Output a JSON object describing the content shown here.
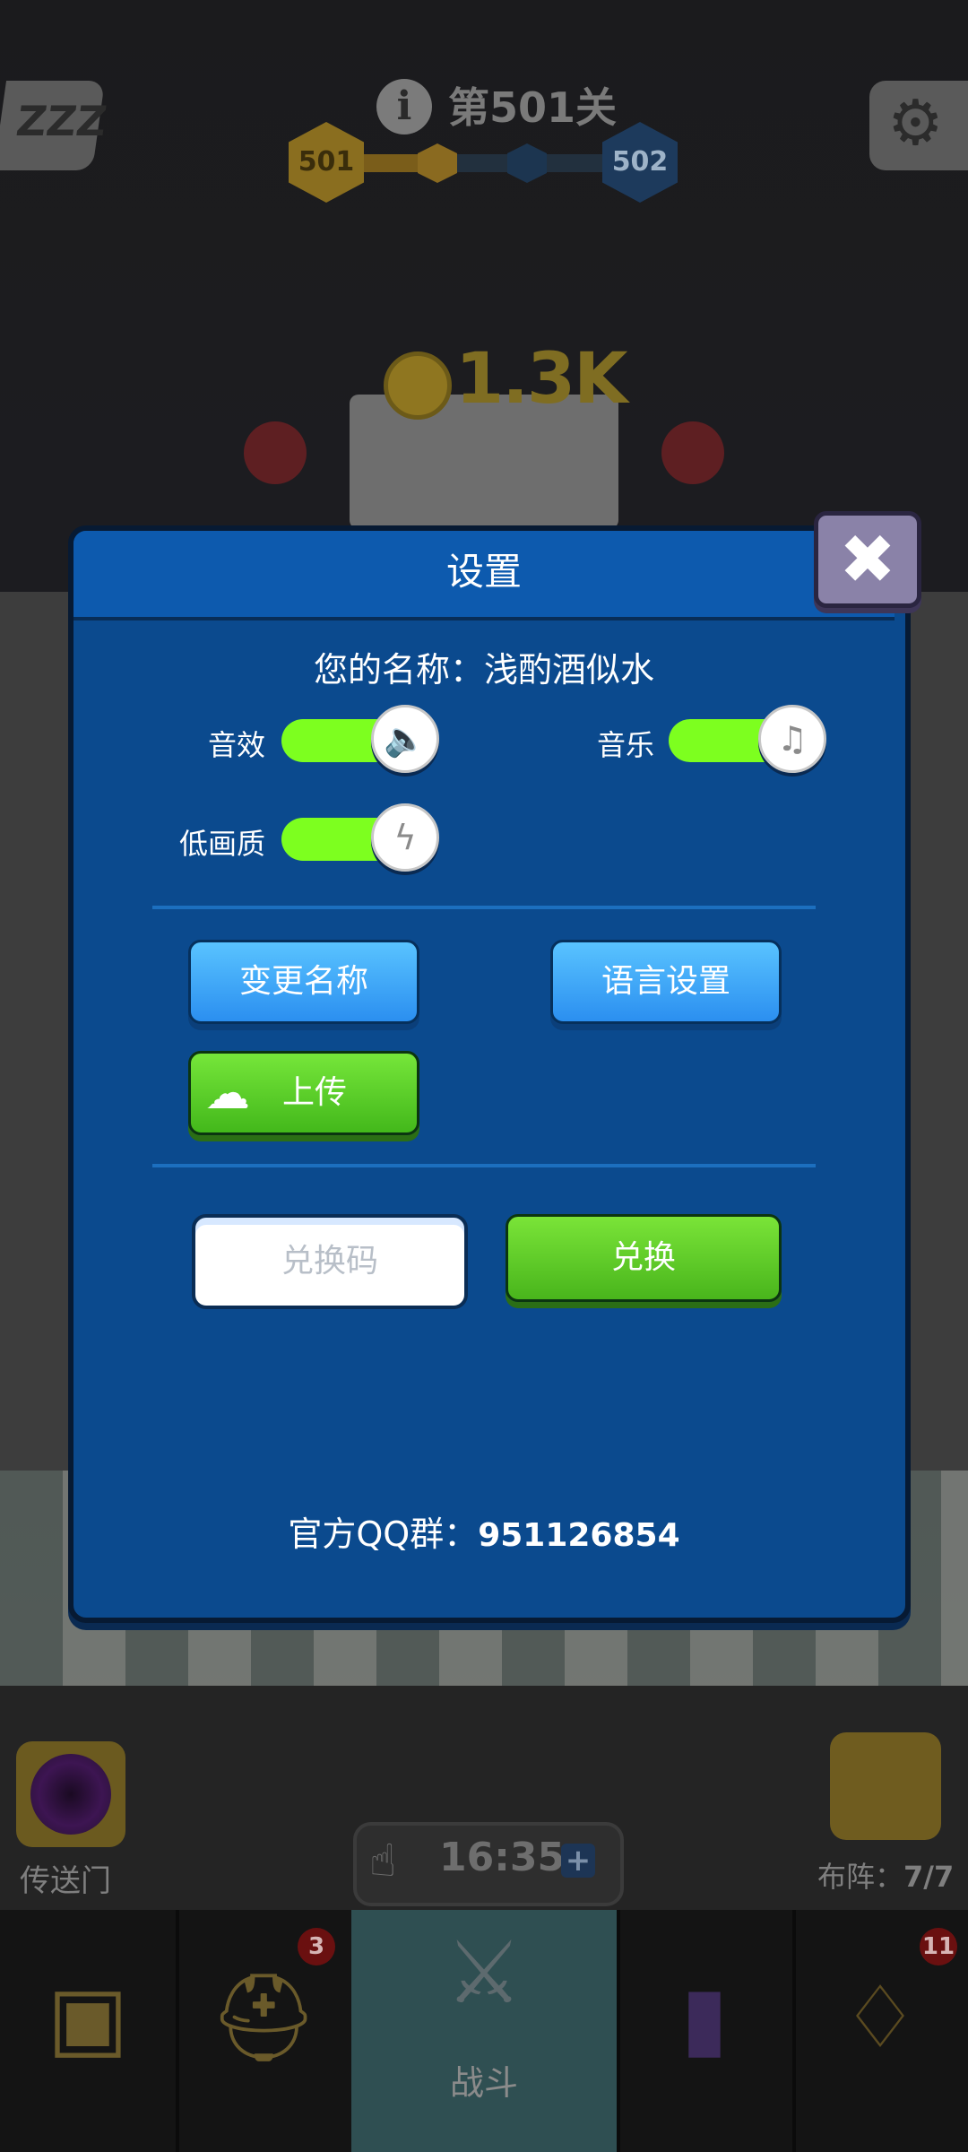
{
  "hud": {
    "level_title": "第501关",
    "current_level": "501",
    "next_level": "502",
    "coin_amount": "1.3K",
    "sleep_icon_text": "ZZZ"
  },
  "dialog": {
    "title": "设置",
    "name_label": "您的名称：",
    "player_name": "浅酌酒似水",
    "options": {
      "sound_label": "音效",
      "music_label": "音乐",
      "low_quality_label": "低画质",
      "sound_on": true,
      "music_on": true,
      "low_quality_on": true
    },
    "buttons": {
      "rename": "变更名称",
      "language": "语言设置",
      "upload": "上传"
    },
    "redeem": {
      "placeholder": "兑换码",
      "button": "兑换"
    },
    "qq_label": "官方QQ群：",
    "qq_number": "951126854"
  },
  "side_buttons": {
    "portal_label": "传送门",
    "lineup_label": "布阵：",
    "lineup_count": "7/7"
  },
  "timer": {
    "value": "16:35",
    "plus": "+"
  },
  "nav": {
    "items": [
      {
        "icon": "treasure-chest-icon",
        "label": ""
      },
      {
        "icon": "viking-helmet-icon",
        "label": "",
        "badge": "3"
      },
      {
        "icon": "crossed-swords-icon",
        "label": "战斗"
      },
      {
        "icon": "spellbook-icon",
        "label": ""
      },
      {
        "icon": "amulet-icon",
        "label": "",
        "badge": "11"
      }
    ]
  },
  "colors": {
    "dialog_bg": "#0b4a8e",
    "toggle_on": "#7dff1f",
    "button_blue": "#2b8ff0",
    "button_green": "#49b51c"
  }
}
